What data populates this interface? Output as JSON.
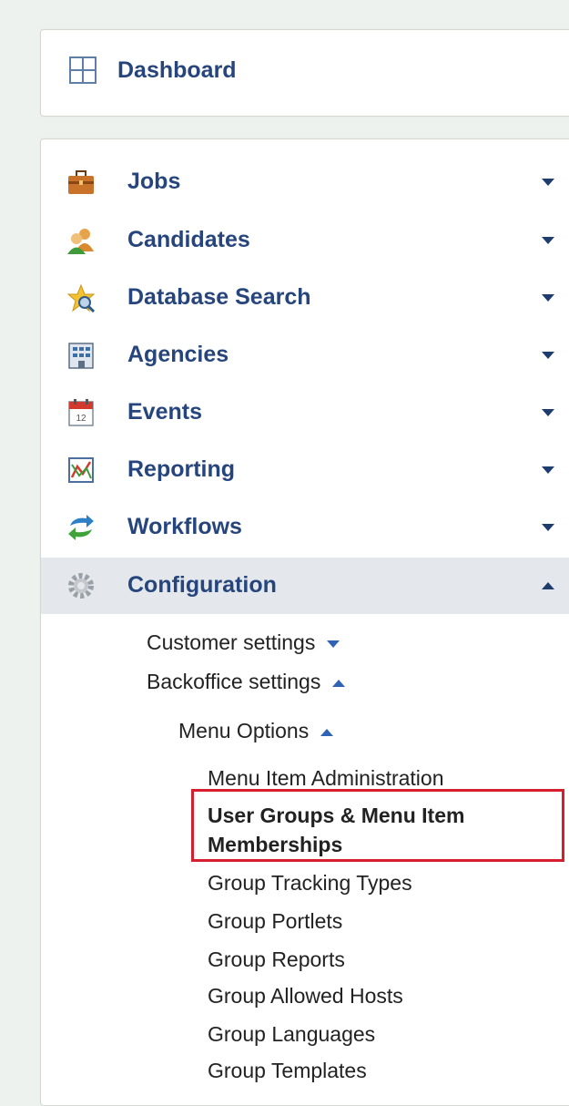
{
  "dashboard": {
    "label": "Dashboard",
    "icon": "dashboard-grid-icon"
  },
  "menu": [
    {
      "label": "Jobs",
      "icon": "briefcase-icon",
      "caret": "down"
    },
    {
      "label": "Candidates",
      "icon": "people-icon",
      "caret": "down"
    },
    {
      "label": "Database Search",
      "icon": "star-search-icon",
      "caret": "down"
    },
    {
      "label": "Agencies",
      "icon": "building-icon",
      "caret": "down"
    },
    {
      "label": "Events",
      "icon": "calendar-icon",
      "caret": "down"
    },
    {
      "label": "Reporting",
      "icon": "chart-icon",
      "caret": "down"
    },
    {
      "label": "Workflows",
      "icon": "workflow-arrows-icon",
      "caret": "down"
    },
    {
      "label": "Configuration",
      "icon": "gear-icon",
      "caret": "up",
      "active": true
    }
  ],
  "configuration": {
    "customer_settings": "Customer settings",
    "backoffice_settings": "Backoffice settings",
    "menu_options": "Menu Options",
    "items": [
      "Menu Item Administration",
      "User Groups & Menu Item",
      "Memberships",
      "Group Tracking Types",
      "Group Portlets",
      "Group Reports",
      "Group Allowed Hosts",
      "Group Languages",
      "Group Templates"
    ],
    "highlighted_item": "User Groups & Menu Item Memberships"
  },
  "colors": {
    "link": "#27457d",
    "highlight_border": "#d51f2e",
    "active_row": "#e4e8ec",
    "background": "#eef2ee"
  }
}
